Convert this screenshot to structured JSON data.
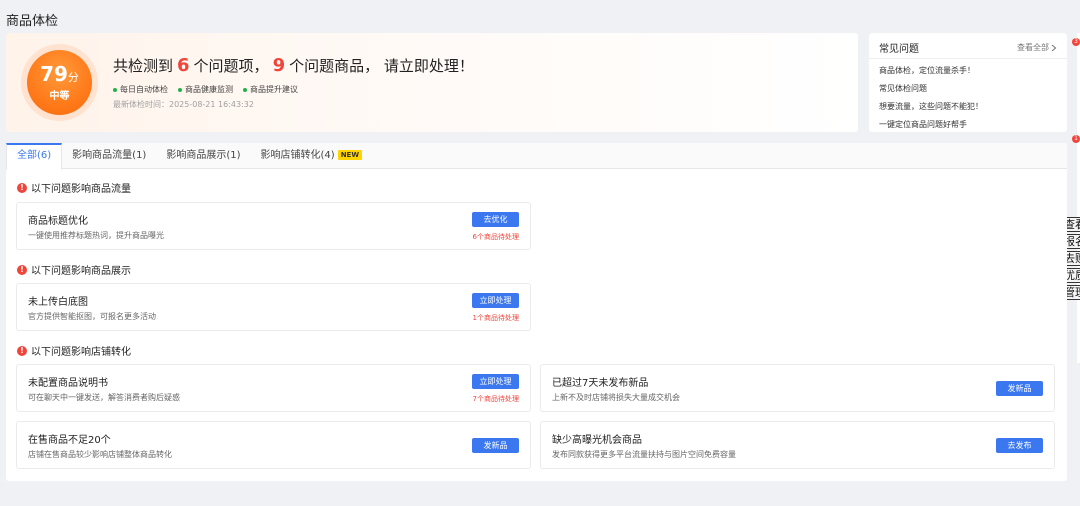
{
  "page": {
    "title": "商品体检"
  },
  "score": {
    "value": "79",
    "unit": "分",
    "grade": "中等",
    "headline": {
      "prefix": "共检测到",
      "issue_count": "6",
      "issue_suffix": "个问题项，",
      "product_count": "9",
      "product_suffix": "个问题商品，  请立即处理！"
    },
    "features": [
      "每日自动体检",
      "商品健康监测",
      "商品提升建议"
    ],
    "last_check": "最新体检时间：2025-08-21 16:43:32"
  },
  "faq": {
    "title": "常见问题",
    "more_label": "查看全部",
    "items": [
      "商品体检，定位流量杀手！",
      "常见体检问题",
      "想要流量，这些问题不能犯！",
      "一键定位商品问题好帮手"
    ]
  },
  "edge": {
    "badges": [
      "3",
      "1"
    ],
    "menu": [
      "查看",
      "报名",
      "去购",
      "优质",
      "管理"
    ]
  },
  "tabs": [
    {
      "label": "全部(6)",
      "active": true
    },
    {
      "label": "影响商品流量(1)"
    },
    {
      "label": "影响商品展示(1)"
    },
    {
      "label": "影响店铺转化(4)",
      "badge": "NEW"
    }
  ],
  "sections": [
    {
      "title": "以下问题影响商品流量",
      "cards": [
        {
          "title": "商品标题优化",
          "desc": "一键使用推荐标题热词，提升商品曝光",
          "button": "去优化",
          "pending": "6个商品待处理"
        }
      ]
    },
    {
      "title": "以下问题影响商品展示",
      "cards": [
        {
          "title": "未上传白底图",
          "desc": "官方提供智能抠图，可报名更多活动",
          "button": "立即处理",
          "pending": "1个商品待处理"
        }
      ]
    },
    {
      "title": "以下问题影响店铺转化",
      "cards": [
        {
          "title": "未配置商品说明书",
          "desc": "可在聊天中一键发送，解答消费者购后疑惑",
          "button": "立即处理",
          "pending": "7个商品待处理"
        },
        {
          "title": "已超过7天未发布新品",
          "desc": "上新不及时店铺将损失大量成交机会",
          "button": "发新品"
        },
        {
          "title": "在售商品不足20个",
          "desc": "店铺在售商品较少影响店铺整体商品转化",
          "button": "发新品"
        },
        {
          "title": "缺少高曝光机会商品",
          "desc": "发布同款获得更多平台流量扶持与图片空间免费容量",
          "button": "去发布"
        }
      ]
    }
  ],
  "colors": {
    "accent": "#3b78f0",
    "danger": "#f0453a",
    "score": "#ff7a1a",
    "ok": "#20b24a"
  }
}
